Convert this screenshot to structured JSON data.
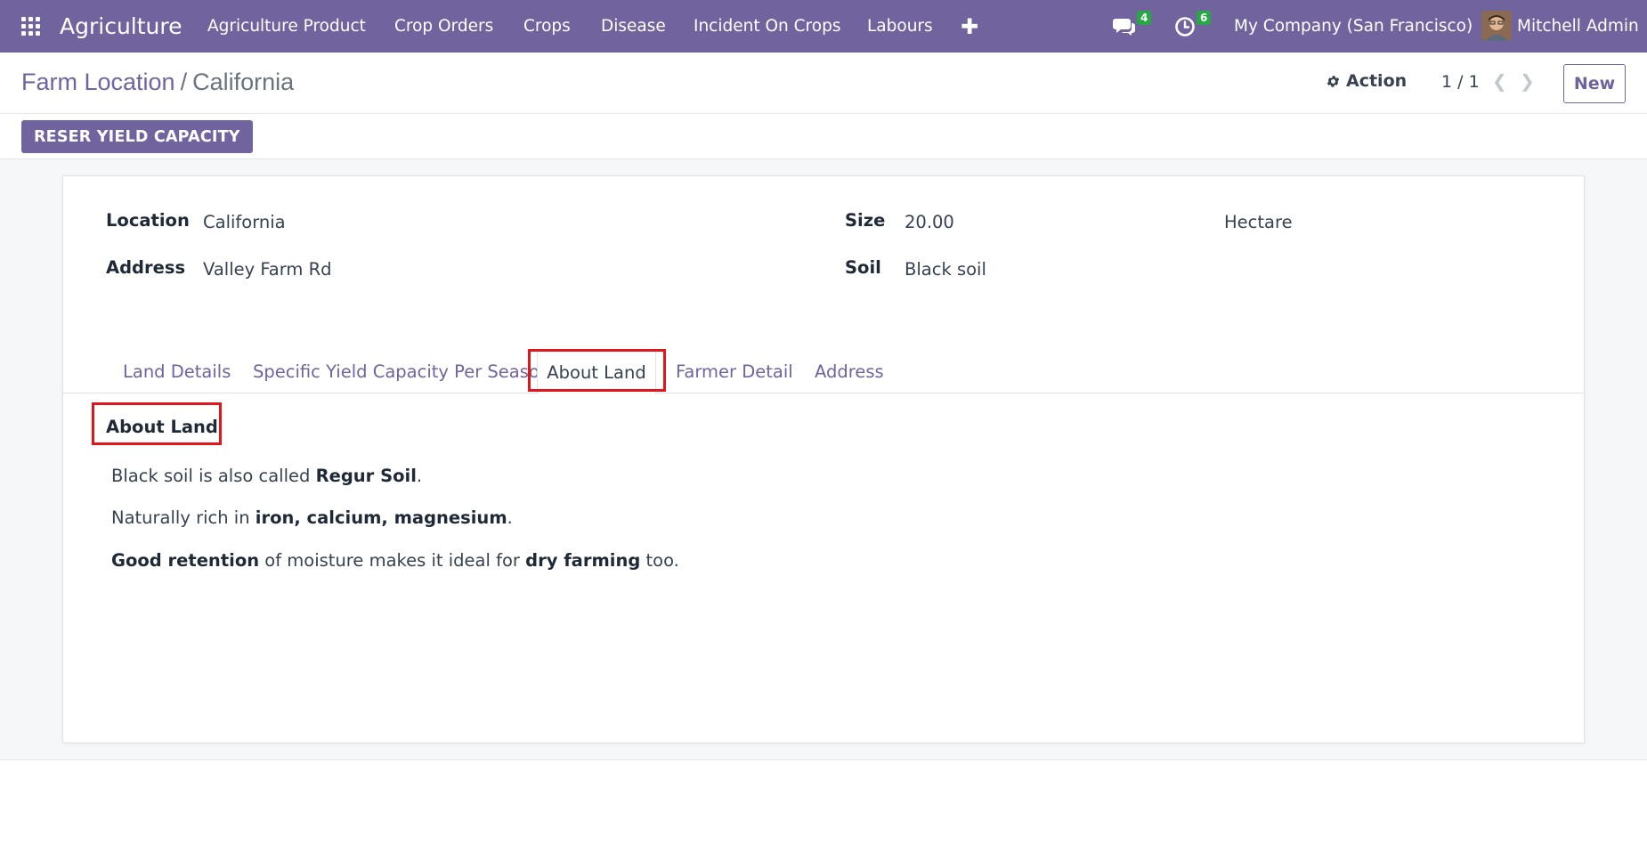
{
  "navbar": {
    "app_name": "Agriculture",
    "menu": [
      "Agriculture Product",
      "Crop Orders",
      "Crops",
      "Disease",
      "Incident On Crops",
      "Labours"
    ],
    "messages_badge": "4",
    "activities_badge": "6",
    "company": "My Company (San Francisco)",
    "user": "Mitchell Admin"
  },
  "control_panel": {
    "breadcrumb_parent": "Farm Location",
    "breadcrumb_separator": "/",
    "breadcrumb_current": "California",
    "action_label": "Action",
    "pager": "1 / 1",
    "new_label": "New"
  },
  "header": {
    "primary_button": "RESER YIELD CAPACITY"
  },
  "form": {
    "location_label": "Location",
    "location_value": "California",
    "address_label": "Address",
    "address_value": "Valley Farm Rd",
    "size_label": "Size",
    "size_value": "20.00",
    "size_unit": "Hectare",
    "soil_label": "Soil",
    "soil_value": "Black soil"
  },
  "tabs": [
    "Land Details",
    "Specific Yield Capacity Per Season",
    "About Land",
    "Farmer Detail",
    "Address"
  ],
  "active_tab": "About Land",
  "about": {
    "title": "About Land",
    "p1_a": "Black soil is also called ",
    "p1_b": "Regur Soil",
    "p1_c": ".",
    "p2_a": "Naturally rich in ",
    "p2_b": "iron, calcium, magnesium",
    "p2_c": ".",
    "p3_a": "Good retention",
    "p3_b": " of moisture makes it ideal for ",
    "p3_c": "dry farming",
    "p3_d": " too."
  },
  "colors": {
    "brand": "#71639e",
    "badge": "#28a745",
    "highlight": "#e0161b"
  }
}
